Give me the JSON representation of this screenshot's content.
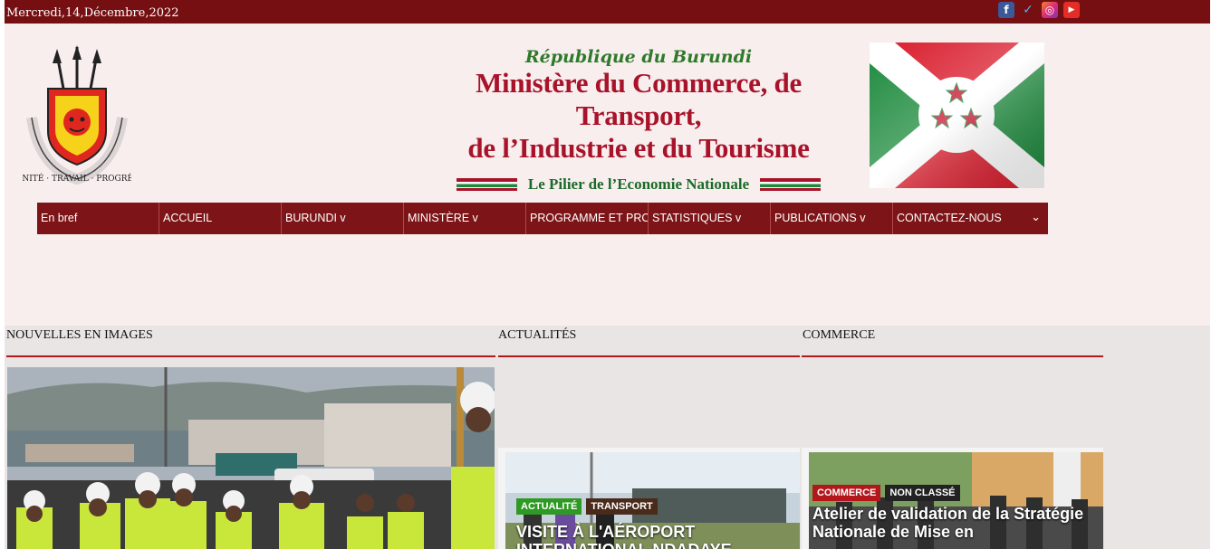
{
  "topbar": {
    "date": "Mercredi,14,Décembre,2022",
    "social": [
      {
        "name": "facebook-icon",
        "glyph": "f",
        "cls": "fb"
      },
      {
        "name": "twitter-icon",
        "glyph": "✓",
        "cls": "tw"
      },
      {
        "name": "instagram-icon",
        "glyph": "◎",
        "cls": "ig"
      },
      {
        "name": "youtube-icon",
        "glyph": "▶",
        "cls": "yt"
      }
    ]
  },
  "header": {
    "republic": "République du Burundi",
    "ministry_line1": "Ministère du Commerce, de Transport,",
    "ministry_line2": "de l’Industrie et du Tourisme",
    "tagline": "Le Pilier de l’Economie Nationale",
    "emblem_motto": "UNITÉ · TRAVAIL · PROGRÈS"
  },
  "nav": {
    "items": [
      {
        "label": "En bref",
        "name": "nav-item-en-bref"
      },
      {
        "label": "ACCUEIL",
        "name": "nav-item-accueil"
      },
      {
        "label": "BURUNDI v",
        "name": "nav-item-burundi"
      },
      {
        "label": "MINISTÈRE v",
        "name": "nav-item-ministere"
      },
      {
        "label": "PROGRAMME ET PRO...",
        "name": "nav-item-programme"
      },
      {
        "label": "STATISTIQUES v",
        "name": "nav-item-statistiques"
      },
      {
        "label": "PUBLICATIONS v",
        "name": "nav-item-publications"
      },
      {
        "label": "CONTACTEZ-NOUS",
        "name": "nav-item-contact"
      }
    ],
    "more_glyph": "⌄"
  },
  "sections": {
    "images_title": "NOUVELLES EN IMAGES",
    "news_title": "ACTUALITÉS",
    "commerce_title": "COMMERCE"
  },
  "cards": {
    "news": {
      "tags": [
        "ACTUALITÉ",
        "TRANSPORT"
      ],
      "headline": "VISITE À L'AÉROPORT INTERNATIONAL NDADAYE"
    },
    "commerce": {
      "tags": [
        "COMMERCE",
        "NON CLASSÉ"
      ],
      "headline": "Atelier de validation de la Stratégie Nationale de Mise en"
    }
  },
  "colors": {
    "brand_dark_red": "#750f12",
    "nav_red": "#7d1417",
    "accent_red": "#b3171c",
    "tag_green": "#2f9a23"
  }
}
